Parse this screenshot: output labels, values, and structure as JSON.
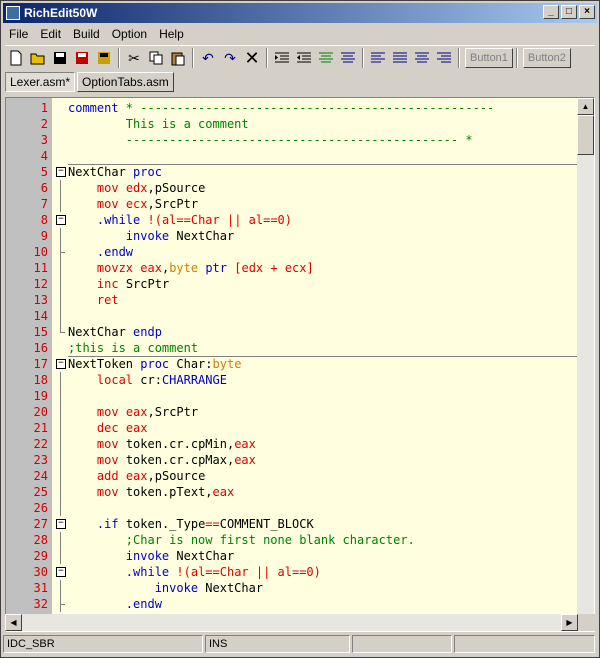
{
  "window": {
    "title": "RichEdit50W"
  },
  "menu": [
    "File",
    "Edit",
    "Build",
    "Option",
    "Help"
  ],
  "toolbar": {
    "buttons": [
      "new-file",
      "open",
      "save",
      "save-red",
      "save-all",
      "cut",
      "copy",
      "paste",
      "undo",
      "redo",
      "delete",
      "indent",
      "outdent",
      "comment",
      "uncomment",
      "align-1",
      "align-2",
      "align-3",
      "align-4"
    ],
    "button1_label": "Button1",
    "button2_label": "Button2"
  },
  "tabs": [
    {
      "label": "Lexer.asm*",
      "active": true
    },
    {
      "label": "OptionTabs.asm",
      "active": false
    }
  ],
  "editor": {
    "lines": [
      {
        "n": "1",
        "fold": "",
        "sep": false,
        "parts": [
          [
            "kw",
            "comment"
          ],
          [
            "cm",
            " * -------------------------------------------------"
          ]
        ]
      },
      {
        "n": "2",
        "fold": "",
        "sep": false,
        "parts": [
          [
            "cm",
            "        This is a comment"
          ]
        ]
      },
      {
        "n": "3",
        "fold": "",
        "sep": false,
        "parts": [
          [
            "cm",
            "        ---------------------------------------------- *"
          ]
        ]
      },
      {
        "n": "4",
        "fold": "",
        "sep": false,
        "parts": [
          [
            "pl",
            ""
          ]
        ]
      },
      {
        "n": "5",
        "fold": "box",
        "sep": true,
        "parts": [
          [
            "pl",
            "NextChar "
          ],
          [
            "kw",
            "proc"
          ]
        ]
      },
      {
        "n": "6",
        "fold": "line",
        "sep": false,
        "parts": [
          [
            "pl",
            "    "
          ],
          [
            "reg",
            "mov"
          ],
          [
            "pl",
            " "
          ],
          [
            "reg",
            "edx"
          ],
          [
            "pl",
            ",pSource"
          ]
        ]
      },
      {
        "n": "7",
        "fold": "line",
        "sep": false,
        "parts": [
          [
            "pl",
            "    "
          ],
          [
            "reg",
            "mov"
          ],
          [
            "pl",
            " "
          ],
          [
            "reg",
            "ecx"
          ],
          [
            "pl",
            ",SrcPtr"
          ]
        ]
      },
      {
        "n": "8",
        "fold": "box",
        "sep": false,
        "parts": [
          [
            "pl",
            "    "
          ],
          [
            "kw",
            ".while"
          ],
          [
            "pl",
            " "
          ],
          [
            "reg",
            "!(al==Char || al==0)"
          ]
        ]
      },
      {
        "n": "9",
        "fold": "line",
        "sep": false,
        "parts": [
          [
            "pl",
            "        "
          ],
          [
            "kw",
            "invoke"
          ],
          [
            "pl",
            " NextChar"
          ]
        ]
      },
      {
        "n": "10",
        "fold": "tick",
        "sep": false,
        "parts": [
          [
            "pl",
            "    "
          ],
          [
            "kw",
            ".endw"
          ]
        ]
      },
      {
        "n": "11",
        "fold": "line",
        "sep": false,
        "parts": [
          [
            "pl",
            "    "
          ],
          [
            "reg",
            "movzx"
          ],
          [
            "pl",
            " "
          ],
          [
            "reg",
            "eax"
          ],
          [
            "pl",
            ","
          ],
          [
            "ty",
            "byte"
          ],
          [
            "pl",
            " "
          ],
          [
            "kw",
            "ptr"
          ],
          [
            "pl",
            " "
          ],
          [
            "reg",
            "[edx + ecx]"
          ]
        ]
      },
      {
        "n": "12",
        "fold": "line",
        "sep": false,
        "parts": [
          [
            "pl",
            "    "
          ],
          [
            "reg",
            "inc"
          ],
          [
            "pl",
            " SrcPtr"
          ]
        ]
      },
      {
        "n": "13",
        "fold": "line",
        "sep": false,
        "parts": [
          [
            "pl",
            "    "
          ],
          [
            "reg",
            "ret"
          ]
        ]
      },
      {
        "n": "14",
        "fold": "line",
        "sep": false,
        "parts": [
          [
            "pl",
            ""
          ]
        ]
      },
      {
        "n": "15",
        "fold": "end",
        "sep": false,
        "parts": [
          [
            "pl",
            "NextChar "
          ],
          [
            "kw",
            "endp"
          ]
        ]
      },
      {
        "n": "16",
        "fold": "",
        "sep": false,
        "parts": [
          [
            "cm",
            ";this is a comment"
          ]
        ]
      },
      {
        "n": "17",
        "fold": "box",
        "sep": true,
        "parts": [
          [
            "pl",
            "NextToken "
          ],
          [
            "kw",
            "proc"
          ],
          [
            "pl",
            " Char:"
          ],
          [
            "ty",
            "byte"
          ]
        ]
      },
      {
        "n": "18",
        "fold": "line",
        "sep": false,
        "parts": [
          [
            "pl",
            "    "
          ],
          [
            "reg",
            "local"
          ],
          [
            "pl",
            " cr:"
          ],
          [
            "kw",
            "CHARRANGE"
          ]
        ]
      },
      {
        "n": "19",
        "fold": "line",
        "sep": false,
        "parts": [
          [
            "pl",
            ""
          ]
        ]
      },
      {
        "n": "20",
        "fold": "line",
        "sep": false,
        "parts": [
          [
            "pl",
            "    "
          ],
          [
            "reg",
            "mov"
          ],
          [
            "pl",
            " "
          ],
          [
            "reg",
            "eax"
          ],
          [
            "pl",
            ",SrcPtr"
          ]
        ]
      },
      {
        "n": "21",
        "fold": "line",
        "sep": false,
        "parts": [
          [
            "pl",
            "    "
          ],
          [
            "reg",
            "dec"
          ],
          [
            "pl",
            " "
          ],
          [
            "reg",
            "eax"
          ]
        ]
      },
      {
        "n": "22",
        "fold": "line",
        "sep": false,
        "parts": [
          [
            "pl",
            "    "
          ],
          [
            "reg",
            "mov"
          ],
          [
            "pl",
            " token.cr.cpMin,"
          ],
          [
            "reg",
            "eax"
          ]
        ]
      },
      {
        "n": "23",
        "fold": "line",
        "sep": false,
        "parts": [
          [
            "pl",
            "    "
          ],
          [
            "reg",
            "mov"
          ],
          [
            "pl",
            " token.cr.cpMax,"
          ],
          [
            "reg",
            "eax"
          ]
        ]
      },
      {
        "n": "24",
        "fold": "line",
        "sep": false,
        "parts": [
          [
            "pl",
            "    "
          ],
          [
            "reg",
            "add"
          ],
          [
            "pl",
            " "
          ],
          [
            "reg",
            "eax"
          ],
          [
            "pl",
            ",pSource"
          ]
        ]
      },
      {
        "n": "25",
        "fold": "line",
        "sep": false,
        "parts": [
          [
            "pl",
            "    "
          ],
          [
            "reg",
            "mov"
          ],
          [
            "pl",
            " token.pText,"
          ],
          [
            "reg",
            "eax"
          ]
        ]
      },
      {
        "n": "26",
        "fold": "line",
        "sep": false,
        "parts": [
          [
            "pl",
            ""
          ]
        ]
      },
      {
        "n": "27",
        "fold": "box",
        "sep": false,
        "parts": [
          [
            "pl",
            "    "
          ],
          [
            "kw",
            ".if"
          ],
          [
            "pl",
            " token._Type"
          ],
          [
            "reg",
            "=="
          ],
          [
            "pl",
            "COMMENT_BLOCK"
          ]
        ]
      },
      {
        "n": "28",
        "fold": "line",
        "sep": false,
        "parts": [
          [
            "pl",
            "        "
          ],
          [
            "cm",
            ";Char is now first none blank character."
          ]
        ]
      },
      {
        "n": "29",
        "fold": "line",
        "sep": false,
        "parts": [
          [
            "pl",
            "        "
          ],
          [
            "kw",
            "invoke"
          ],
          [
            "pl",
            " NextChar"
          ]
        ]
      },
      {
        "n": "30",
        "fold": "box",
        "sep": false,
        "parts": [
          [
            "pl",
            "        "
          ],
          [
            "kw",
            ".while"
          ],
          [
            "pl",
            " "
          ],
          [
            "reg",
            "!(al==Char || al==0)"
          ]
        ]
      },
      {
        "n": "31",
        "fold": "line",
        "sep": false,
        "parts": [
          [
            "pl",
            "            "
          ],
          [
            "kw",
            "invoke"
          ],
          [
            "pl",
            " NextChar"
          ]
        ]
      },
      {
        "n": "32",
        "fold": "tick",
        "sep": false,
        "parts": [
          [
            "pl",
            "        "
          ],
          [
            "kw",
            ".endw"
          ]
        ]
      }
    ]
  },
  "statusbar": {
    "panel1": "IDC_SBR",
    "panel2": "INS",
    "panel3": "",
    "panel4": ""
  }
}
